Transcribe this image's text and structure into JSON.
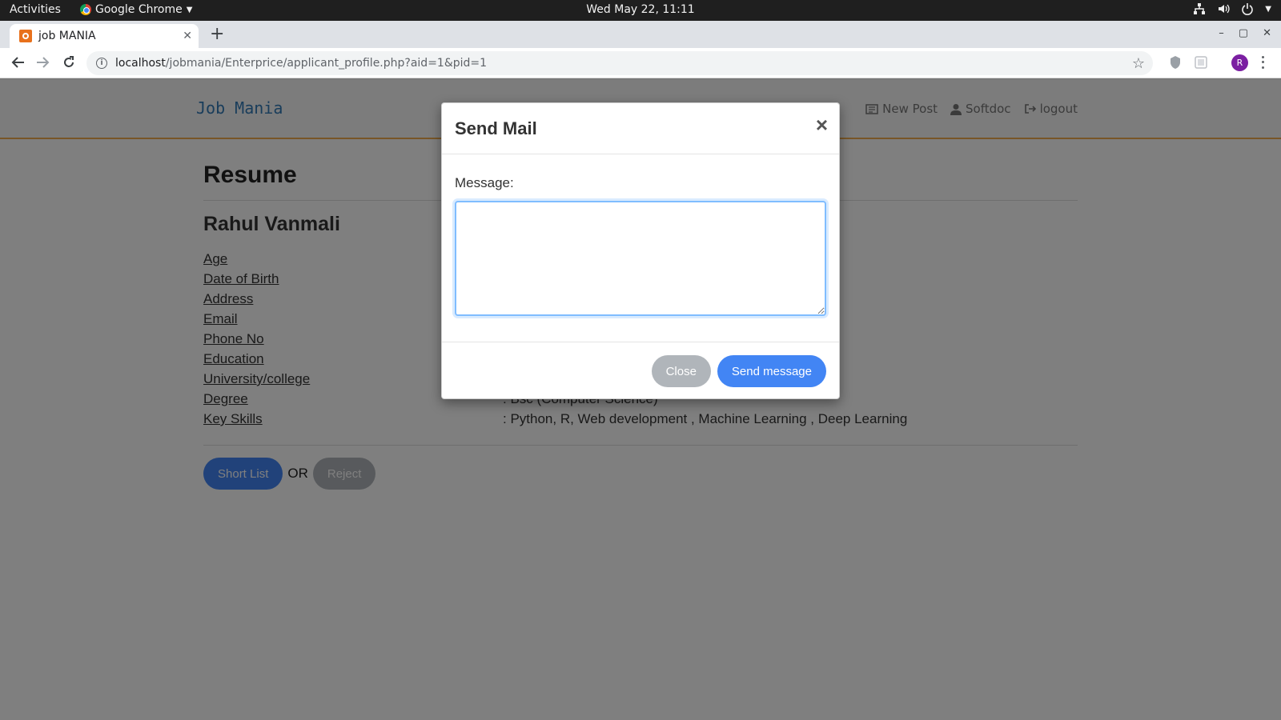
{
  "os": {
    "activities": "Activities",
    "app_name": "Google Chrome",
    "clock": "Wed May 22, 11:11"
  },
  "browser": {
    "tab_title": "job MANIA",
    "url_host": "localhost",
    "url_path": "/jobmania/Enterprice/applicant_profile.php?aid=1&pid=1",
    "profile_initial": "R"
  },
  "navbar": {
    "brand": "Job Mania",
    "links": {
      "new_post": "New Post",
      "user": "Softdoc",
      "logout": "logout"
    }
  },
  "resume": {
    "heading": "Resume",
    "name": "Rahul Vanmali",
    "fields": [
      {
        "label": "Age",
        "value": ""
      },
      {
        "label": "Date of Birth",
        "value": ""
      },
      {
        "label": "Address",
        "value": ""
      },
      {
        "label": "Email",
        "value": ""
      },
      {
        "label": "Phone No",
        "value": ""
      },
      {
        "label": "Education",
        "value": ""
      },
      {
        "label": "University/college",
        "value": ""
      },
      {
        "label": "Degree",
        "value": ": Bsc (Computer Science)"
      },
      {
        "label": "Key Skills",
        "value": ": Python, R, Web development , Machine Learning , Deep Learning"
      }
    ],
    "shortlist_label": "Short List",
    "or_text": "OR",
    "reject_label": "Reject"
  },
  "modal": {
    "title": "Send Mail",
    "close_symbol": "×",
    "message_label": "Message:",
    "message_value": "",
    "close_label": "Close",
    "send_label": "Send message"
  },
  "colors": {
    "primary": "#4285f4",
    "secondary": "#b0b5ba",
    "navbar_accent": "#f0ad4e",
    "brand": "#337ab7"
  }
}
